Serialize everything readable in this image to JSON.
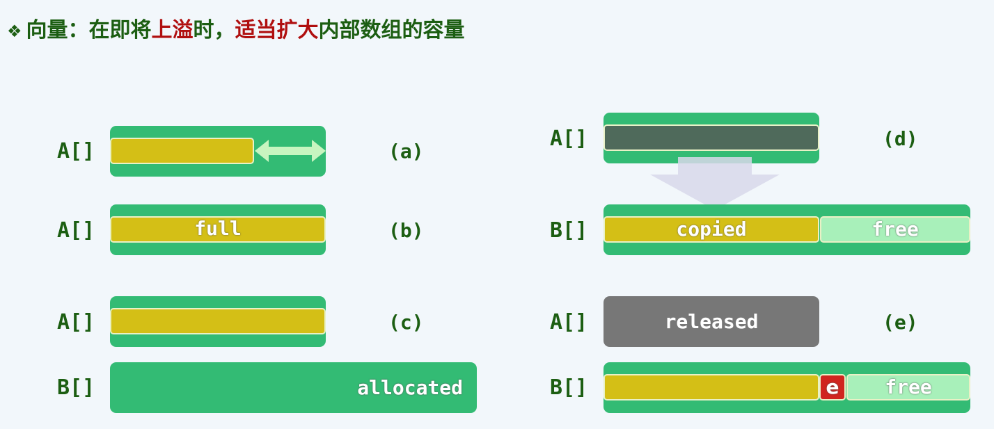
{
  "title": {
    "bullet": "❖",
    "p1": "向量：在即将",
    "p2": "上溢",
    "p3": "时，",
    "p4": "适当扩大",
    "p5": "内部数组的容量"
  },
  "labels": {
    "a_arr": "A[]",
    "b_arr": "A[]",
    "c_arr_a": "A[]",
    "c_arr_b": "B[]",
    "d_arr_a": "A[]",
    "d_arr_b": "B[]",
    "e_arr_a": "A[]",
    "e_arr_b": "B[]"
  },
  "captions": {
    "a": "(a)",
    "b": "(b)",
    "c": "(c)",
    "d": "(d)",
    "e": "(e)"
  },
  "texts": {
    "full": "full",
    "allocated": "allocated",
    "copied": "copied",
    "free_d": "free",
    "released": "released",
    "e_cell": "e",
    "free_e": "free"
  },
  "colors": {
    "container": "#33bb74",
    "used": "#d4bf16",
    "old_array": "#4f6a5b",
    "free": "#a8f0ba",
    "released": "#777777",
    "new_element": "#d0251f",
    "title_green": "#1c5e12",
    "title_red": "#b00f0f"
  }
}
